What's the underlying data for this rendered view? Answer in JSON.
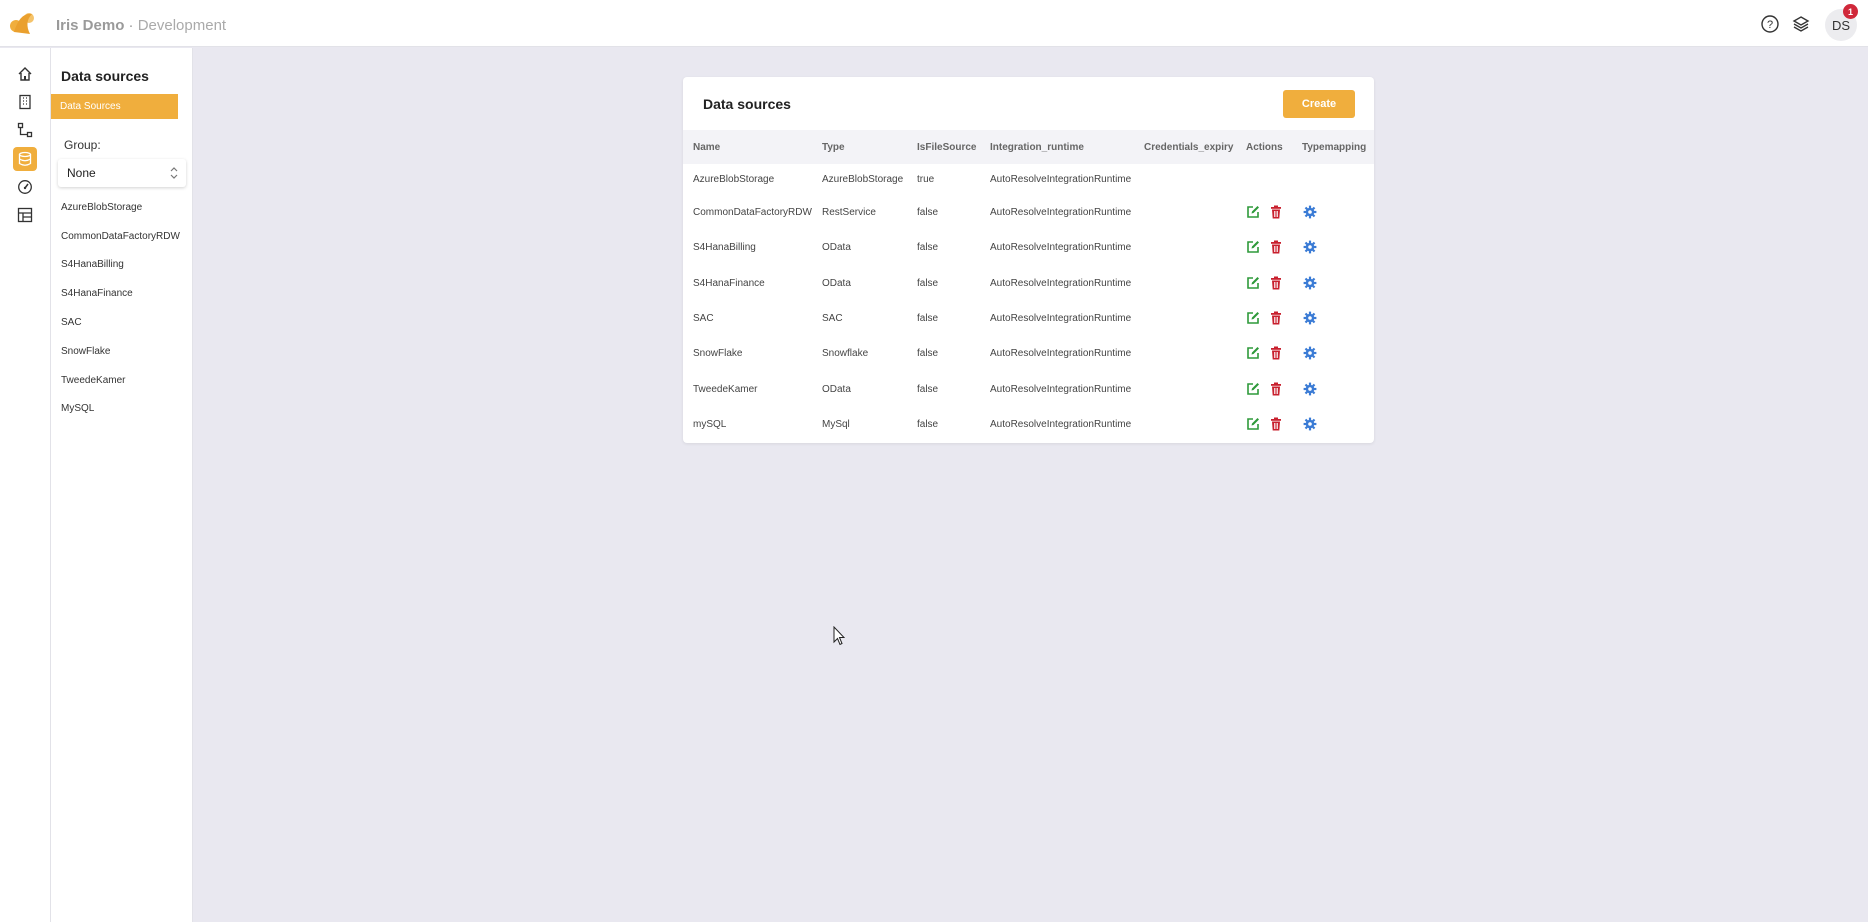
{
  "header": {
    "app_name": "Iris Demo",
    "separator": " · ",
    "environment": "Development",
    "user_initials": "DS",
    "notification_count": "1",
    "icons": [
      "help-icon",
      "layers-icon"
    ]
  },
  "rail": {
    "items": [
      "home-icon",
      "building-icon",
      "pipeline-icon",
      "database-icon",
      "gauge-icon",
      "table-icon"
    ],
    "active_index": 3
  },
  "sidebar": {
    "title": "Data sources",
    "active_item": "Data Sources",
    "group_label": "Group:",
    "group_value": "None",
    "items": [
      "AzureBlobStorage",
      "CommonDataFactoryRDW",
      "S4HanaBilling",
      "S4HanaFinance",
      "SAC",
      "SnowFlake",
      "TweedeKamer",
      "MySQL"
    ]
  },
  "main": {
    "title": "Data sources",
    "create_label": "Create",
    "columns": [
      "Name",
      "Type",
      "IsFileSource",
      "Integration_runtime",
      "Credentials_expiry",
      "Actions",
      "Typemapping"
    ],
    "rows": [
      {
        "name": "AzureBlobStorage",
        "type": "AzureBlobStorage",
        "is_file_source": "true",
        "runtime": "AutoResolveIntegrationRuntime",
        "expiry": "",
        "actions": false
      },
      {
        "name": "CommonDataFactoryRDW",
        "type": "RestService",
        "is_file_source": "false",
        "runtime": "AutoResolveIntegrationRuntime",
        "expiry": "",
        "actions": true
      },
      {
        "name": "S4HanaBilling",
        "type": "OData",
        "is_file_source": "false",
        "runtime": "AutoResolveIntegrationRuntime",
        "expiry": "",
        "actions": true
      },
      {
        "name": "S4HanaFinance",
        "type": "OData",
        "is_file_source": "false",
        "runtime": "AutoResolveIntegrationRuntime",
        "expiry": "",
        "actions": true
      },
      {
        "name": "SAC",
        "type": "SAC",
        "is_file_source": "false",
        "runtime": "AutoResolveIntegrationRuntime",
        "expiry": "",
        "actions": true
      },
      {
        "name": "SnowFlake",
        "type": "Snowflake",
        "is_file_source": "false",
        "runtime": "AutoResolveIntegrationRuntime",
        "expiry": "",
        "actions": true
      },
      {
        "name": "TweedeKamer",
        "type": "OData",
        "is_file_source": "false",
        "runtime": "AutoResolveIntegrationRuntime",
        "expiry": "",
        "actions": true
      },
      {
        "name": "mySQL",
        "type": "MySql",
        "is_file_source": "false",
        "runtime": "AutoResolveIntegrationRuntime",
        "expiry": "",
        "actions": true
      }
    ]
  },
  "colors": {
    "accent": "#f0ae3d",
    "edit": "#2e9a3a",
    "delete": "#c8202e",
    "settings": "#3a7bd5",
    "badge": "#d0283a"
  }
}
